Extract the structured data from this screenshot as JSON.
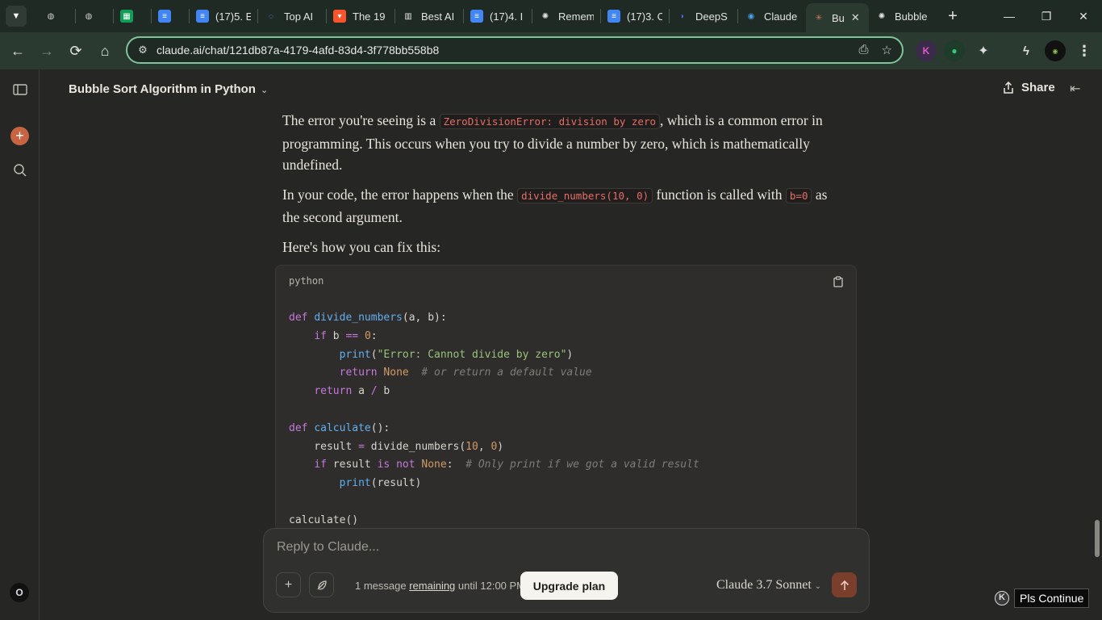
{
  "browser": {
    "tabs": [
      {
        "label": "",
        "icon": "globe"
      },
      {
        "label": "",
        "icon": "globe"
      },
      {
        "label": "",
        "icon": "sheets"
      },
      {
        "label": "",
        "icon": "docs"
      },
      {
        "label": "(17)5. E",
        "icon": "docs"
      },
      {
        "label": "Top AI",
        "icon": "loop"
      },
      {
        "label": "The 19",
        "icon": "brave"
      },
      {
        "label": "Best AI",
        "icon": "board"
      },
      {
        "label": "(17)4. I",
        "icon": "docs"
      },
      {
        "label": "Remem",
        "icon": "openai"
      },
      {
        "label": "(17)3. C",
        "icon": "docs"
      },
      {
        "label": "DeepS",
        "icon": "deepseek"
      },
      {
        "label": "Claude",
        "icon": "claude-app"
      },
      {
        "label": "Bu",
        "icon": "claude",
        "active": true
      },
      {
        "label": "Bubble",
        "icon": "openai"
      }
    ],
    "url": "claude.ai/chat/121db87a-4179-4afd-83d4-3f778bb558b8"
  },
  "chat": {
    "title": "Bubble Sort Algorithm in Python",
    "share_label": "Share",
    "p1": {
      "a": "The error you're seeing is a ",
      "code": "ZeroDivisionError: division by zero",
      "b": ", which is a common error in programming. This occurs when you try to divide a number by zero, which is mathematically undefined."
    },
    "p2": {
      "a": "In your code, the error happens when the ",
      "code1": "divide_numbers(10, 0)",
      "b": " function is called with ",
      "code2": "b=0",
      "c": " as the second argument."
    },
    "p3": "Here's how you can fix this:",
    "code_lang": "python"
  },
  "composer": {
    "placeholder": "Reply to Claude...",
    "limit_prefix": "1 message ",
    "limit_link": "remaining",
    "limit_suffix": " until 12:00 PM",
    "upgrade_label": "Upgrade plan",
    "model": "Claude 3.7 Sonnet"
  },
  "overlay": {
    "k_label": "K",
    "pls_label": "Pls Continue"
  },
  "rail": {
    "avatar": "O"
  },
  "colors": {
    "accent": "#c96442",
    "inline_code": "#e66d67",
    "browser_frame": "#2b3a31"
  }
}
